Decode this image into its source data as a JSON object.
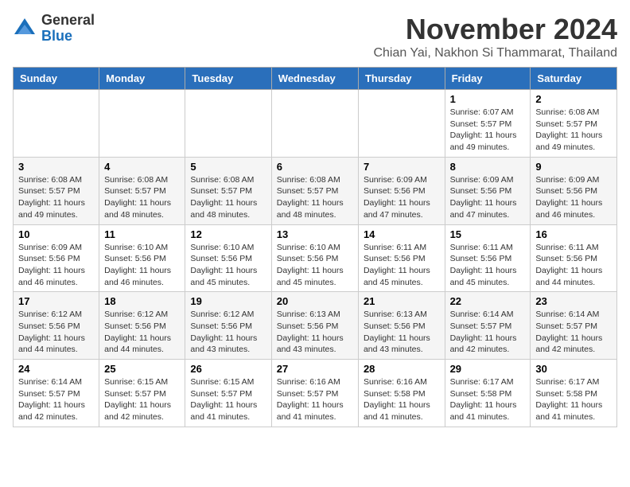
{
  "header": {
    "logo_general": "General",
    "logo_blue": "Blue",
    "month_title": "November 2024",
    "location": "Chian Yai, Nakhon Si Thammarat, Thailand"
  },
  "days_of_week": [
    "Sunday",
    "Monday",
    "Tuesday",
    "Wednesday",
    "Thursday",
    "Friday",
    "Saturday"
  ],
  "weeks": [
    [
      {
        "day": "",
        "info": ""
      },
      {
        "day": "",
        "info": ""
      },
      {
        "day": "",
        "info": ""
      },
      {
        "day": "",
        "info": ""
      },
      {
        "day": "",
        "info": ""
      },
      {
        "day": "1",
        "info": "Sunrise: 6:07 AM\nSunset: 5:57 PM\nDaylight: 11 hours and 49 minutes."
      },
      {
        "day": "2",
        "info": "Sunrise: 6:08 AM\nSunset: 5:57 PM\nDaylight: 11 hours and 49 minutes."
      }
    ],
    [
      {
        "day": "3",
        "info": "Sunrise: 6:08 AM\nSunset: 5:57 PM\nDaylight: 11 hours and 49 minutes."
      },
      {
        "day": "4",
        "info": "Sunrise: 6:08 AM\nSunset: 5:57 PM\nDaylight: 11 hours and 48 minutes."
      },
      {
        "day": "5",
        "info": "Sunrise: 6:08 AM\nSunset: 5:57 PM\nDaylight: 11 hours and 48 minutes."
      },
      {
        "day": "6",
        "info": "Sunrise: 6:08 AM\nSunset: 5:57 PM\nDaylight: 11 hours and 48 minutes."
      },
      {
        "day": "7",
        "info": "Sunrise: 6:09 AM\nSunset: 5:56 PM\nDaylight: 11 hours and 47 minutes."
      },
      {
        "day": "8",
        "info": "Sunrise: 6:09 AM\nSunset: 5:56 PM\nDaylight: 11 hours and 47 minutes."
      },
      {
        "day": "9",
        "info": "Sunrise: 6:09 AM\nSunset: 5:56 PM\nDaylight: 11 hours and 46 minutes."
      }
    ],
    [
      {
        "day": "10",
        "info": "Sunrise: 6:09 AM\nSunset: 5:56 PM\nDaylight: 11 hours and 46 minutes."
      },
      {
        "day": "11",
        "info": "Sunrise: 6:10 AM\nSunset: 5:56 PM\nDaylight: 11 hours and 46 minutes."
      },
      {
        "day": "12",
        "info": "Sunrise: 6:10 AM\nSunset: 5:56 PM\nDaylight: 11 hours and 45 minutes."
      },
      {
        "day": "13",
        "info": "Sunrise: 6:10 AM\nSunset: 5:56 PM\nDaylight: 11 hours and 45 minutes."
      },
      {
        "day": "14",
        "info": "Sunrise: 6:11 AM\nSunset: 5:56 PM\nDaylight: 11 hours and 45 minutes."
      },
      {
        "day": "15",
        "info": "Sunrise: 6:11 AM\nSunset: 5:56 PM\nDaylight: 11 hours and 45 minutes."
      },
      {
        "day": "16",
        "info": "Sunrise: 6:11 AM\nSunset: 5:56 PM\nDaylight: 11 hours and 44 minutes."
      }
    ],
    [
      {
        "day": "17",
        "info": "Sunrise: 6:12 AM\nSunset: 5:56 PM\nDaylight: 11 hours and 44 minutes."
      },
      {
        "day": "18",
        "info": "Sunrise: 6:12 AM\nSunset: 5:56 PM\nDaylight: 11 hours and 44 minutes."
      },
      {
        "day": "19",
        "info": "Sunrise: 6:12 AM\nSunset: 5:56 PM\nDaylight: 11 hours and 43 minutes."
      },
      {
        "day": "20",
        "info": "Sunrise: 6:13 AM\nSunset: 5:56 PM\nDaylight: 11 hours and 43 minutes."
      },
      {
        "day": "21",
        "info": "Sunrise: 6:13 AM\nSunset: 5:56 PM\nDaylight: 11 hours and 43 minutes."
      },
      {
        "day": "22",
        "info": "Sunrise: 6:14 AM\nSunset: 5:57 PM\nDaylight: 11 hours and 42 minutes."
      },
      {
        "day": "23",
        "info": "Sunrise: 6:14 AM\nSunset: 5:57 PM\nDaylight: 11 hours and 42 minutes."
      }
    ],
    [
      {
        "day": "24",
        "info": "Sunrise: 6:14 AM\nSunset: 5:57 PM\nDaylight: 11 hours and 42 minutes."
      },
      {
        "day": "25",
        "info": "Sunrise: 6:15 AM\nSunset: 5:57 PM\nDaylight: 11 hours and 42 minutes."
      },
      {
        "day": "26",
        "info": "Sunrise: 6:15 AM\nSunset: 5:57 PM\nDaylight: 11 hours and 41 minutes."
      },
      {
        "day": "27",
        "info": "Sunrise: 6:16 AM\nSunset: 5:57 PM\nDaylight: 11 hours and 41 minutes."
      },
      {
        "day": "28",
        "info": "Sunrise: 6:16 AM\nSunset: 5:58 PM\nDaylight: 11 hours and 41 minutes."
      },
      {
        "day": "29",
        "info": "Sunrise: 6:17 AM\nSunset: 5:58 PM\nDaylight: 11 hours and 41 minutes."
      },
      {
        "day": "30",
        "info": "Sunrise: 6:17 AM\nSunset: 5:58 PM\nDaylight: 11 hours and 41 minutes."
      }
    ]
  ]
}
